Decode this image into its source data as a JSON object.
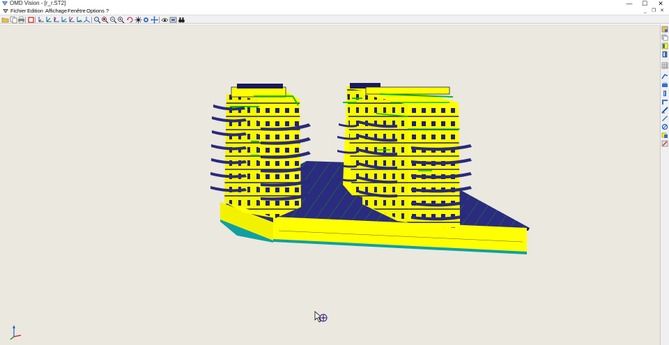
{
  "window": {
    "title": "OMD Vision - [r_r.ST2]",
    "minimize_glyph": "—",
    "maximize_glyph": "☐",
    "close_glyph": "✕"
  },
  "menu": {
    "items": [
      {
        "label": "Fichier"
      },
      {
        "label": "Edition"
      },
      {
        "label": "Affichage"
      },
      {
        "label": "Fenêtre"
      },
      {
        "label": "Options"
      },
      {
        "label": "?"
      }
    ],
    "mdi_minimize_glyph": "_",
    "mdi_restore_glyph": "❐",
    "mdi_close_glyph": "✕"
  },
  "toolbar": {
    "buttons": [
      {
        "icon": "open-folder-icon"
      },
      {
        "icon": "copy-icon"
      },
      {
        "icon": "print-icon"
      },
      {
        "icon": "red-box-icon"
      },
      {
        "icon": "axis-y-icon"
      },
      {
        "icon": "axis-x-icon"
      },
      {
        "icon": "axis-z-icon"
      },
      {
        "icon": "axis-xy-icon"
      },
      {
        "icon": "axis-xz-icon"
      },
      {
        "icon": "axis-yz-icon"
      },
      {
        "icon": "axis-iso-icon"
      },
      {
        "icon": "zoom-icon"
      },
      {
        "icon": "zoom-window-icon"
      },
      {
        "icon": "zoom-previous-icon"
      },
      {
        "icon": "zoom-all-icon"
      },
      {
        "icon": "rotate-icon"
      },
      {
        "icon": "orbit-icon"
      },
      {
        "icon": "pan-icon"
      },
      {
        "icon": "eye-icon"
      },
      {
        "icon": "render-icon"
      },
      {
        "icon": "binoculars-icon"
      }
    ]
  },
  "right_toolbar": {
    "buttons": [
      {
        "icon": "view-cube-icon"
      },
      {
        "icon": "layers-icon"
      },
      {
        "icon": "filter-icon"
      },
      {
        "icon": "section-icon"
      },
      {
        "icon": "grid-icon"
      },
      {
        "icon": "wall-icon"
      },
      {
        "icon": "slab-icon"
      },
      {
        "icon": "column-icon"
      },
      {
        "icon": "beam-icon"
      },
      {
        "icon": "stair-icon"
      },
      {
        "icon": "roof-icon"
      },
      {
        "icon": "opening-icon"
      },
      {
        "icon": "load-icon"
      },
      {
        "icon": "support-icon"
      },
      {
        "icon": "results-icon"
      }
    ]
  },
  "colors": {
    "viewport_bg": "#eae8df",
    "building_yellow": "#ffff00",
    "slab_blue": "#2b2b80",
    "edge_green": "#00b000",
    "toolbar_bg": "#f0f0f0"
  }
}
